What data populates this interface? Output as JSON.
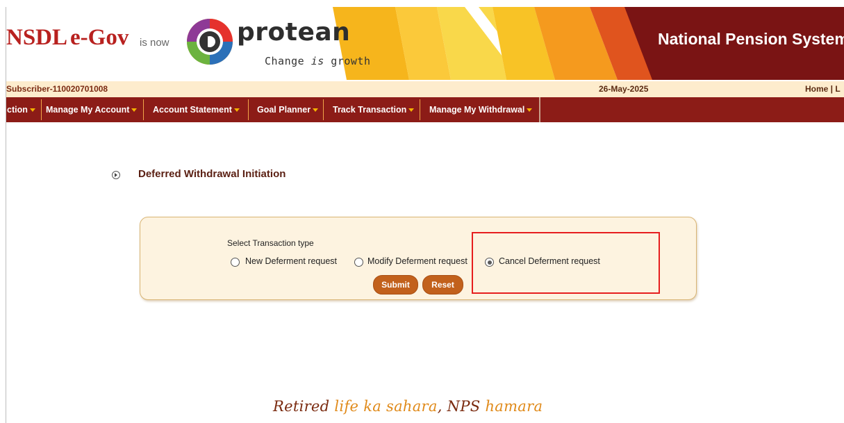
{
  "header": {
    "brand_part1": "NSDL",
    "brand_part2": "e-Gov",
    "is_now": "is now",
    "logo_name": "protean",
    "tagline_a": "Change ",
    "tagline_b": "is",
    "tagline_c": " growth",
    "right_title": "National Pension System ("
  },
  "infobar": {
    "subscriber": "Subscriber-110020701008",
    "date": "26-May-2025",
    "links": "Home | L"
  },
  "menu": {
    "items": [
      {
        "label": "ction"
      },
      {
        "label": "Manage My Account"
      },
      {
        "label": "Account Statement"
      },
      {
        "label": "Goal Planner"
      },
      {
        "label": "Track Transaction"
      },
      {
        "label": "Manage My Withdrawal"
      }
    ]
  },
  "page": {
    "title": "Deferred Withdrawal Initiation",
    "select_label": "Select Transaction type",
    "options": [
      {
        "label": "New Deferment request",
        "checked": false
      },
      {
        "label": "Modify Deferment request",
        "checked": false
      },
      {
        "label": "Cancel Deferment request",
        "checked": true
      }
    ],
    "submit_label": "Submit",
    "reset_label": "Reset"
  },
  "footer": {
    "slogan_a": "Retired ",
    "slogan_b": "life ka sahara",
    "slogan_c": ", NPS ",
    "slogan_d": "hamara"
  },
  "colors": {
    "brand_red": "#b8211f",
    "menu_bg": "#8c1c17",
    "infobar_bg": "#fdeccd",
    "panel_bg": "#fdf3e0",
    "button": "#c2611c",
    "highlight": "#e61e1e"
  }
}
